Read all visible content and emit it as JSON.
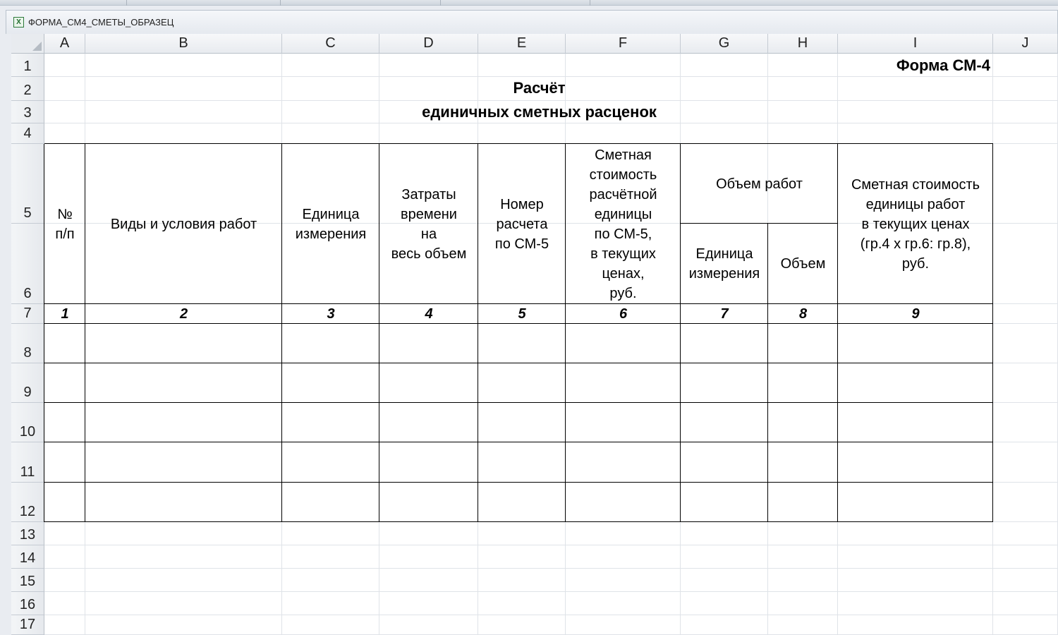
{
  "window": {
    "workbook_title": "ФОРМА_СМ4_СМЕТЫ_ОБРАЗЕЦ",
    "icon": "excel-workbook-icon",
    "icon_glyph": "X"
  },
  "sheet": {
    "columns": [
      "A",
      "B",
      "C",
      "D",
      "E",
      "F",
      "G",
      "H",
      "I",
      "J"
    ],
    "rows": [
      "1",
      "2",
      "3",
      "4",
      "5",
      "6",
      "7",
      "8",
      "9",
      "10",
      "11",
      "12",
      "13",
      "14",
      "15",
      "16",
      "17"
    ]
  },
  "document": {
    "form_label": "Форма СМ-4",
    "title_line1": "Расчёт",
    "title_line2": "единичных сметных расценок",
    "headers": {
      "num": "№\nп/п",
      "work": "Виды и условия работ",
      "unit": "Единица\nизмерения",
      "time": "Затраты\nвремени\nна\nвесь объем",
      "calc": "Номер\nрасчета\nпо СМ-5",
      "cost": "Сметная\nстоимость\nрасчётной\nединицы\nпо СМ-5,\nв текущих\nценах,\nруб.",
      "volume_group": "Объем работ",
      "vol_unit": "Единица\nизмерения",
      "vol_amount": "Объем",
      "unit_cost": "Сметная стоимость\nединицы работ\nв текущих ценах\n(гр.4 х гр.6: гр.8),\nруб."
    },
    "column_numbers": [
      "1",
      "2",
      "3",
      "4",
      "5",
      "6",
      "7",
      "8",
      "9"
    ]
  }
}
